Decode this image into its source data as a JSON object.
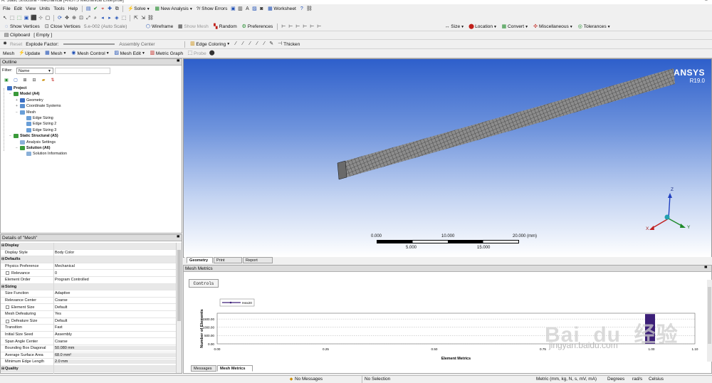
{
  "window": {
    "title": "A: Static Structural - Mechanical [ANSYS Mechanical Enterprise]"
  },
  "menu": [
    "File",
    "Edit",
    "View",
    "Units",
    "Tools",
    "Help"
  ],
  "toolbar1": {
    "solve": "Solve",
    "new_analysis": "New Analysis",
    "show_errors": "?/ Show Errors",
    "worksheet": "Worksheet"
  },
  "toolbar2": {},
  "toolbar3": {
    "show_vertices": "Show Vertices",
    "close_vertices": "Close Vertices",
    "tolerance": "5.e-002 (Auto Scale)",
    "wireframe": "Wireframe",
    "show_mesh": "Show Mesh",
    "random": "Random",
    "preferences": "Preferences",
    "size": "Size",
    "location": "Location",
    "convert": "Convert",
    "misc": "Miscellaneous",
    "tolerances": "Tolerances"
  },
  "toolbar4": {
    "clipboard": "Clipboard",
    "clipboard_state": "[ Empty ]"
  },
  "toolbar5": {
    "reset": "Reset",
    "explode_factor": "Explode Factor:",
    "assembly_center": "Assembly Center",
    "edge_coloring": "Edge Coloring",
    "thicken": "Thicken"
  },
  "toolbar6": {
    "mesh": "Mesh",
    "update": "Update",
    "mesh_menu": "Mesh",
    "mesh_control": "Mesh Control",
    "mesh_edit": "Mesh Edit",
    "metric_graph": "Metric Graph",
    "probe": "Probe"
  },
  "outline": {
    "title": "Outline",
    "pin": "▀",
    "filter_label": "Filter:",
    "filter_value": "Name",
    "nodes": [
      {
        "label": "Project",
        "level": 0,
        "bold": true,
        "color": "#3a6fc4",
        "expander": ""
      },
      {
        "label": "Model (A4)",
        "level": 1,
        "bold": true,
        "color": "#3a9a3a",
        "expander": "−"
      },
      {
        "label": "Geometry",
        "level": 2,
        "bold": false,
        "color": "#3a6fc4",
        "expander": "+"
      },
      {
        "label": "Coordinate Systems",
        "level": 2,
        "bold": false,
        "color": "#5a8fd0",
        "expander": "+"
      },
      {
        "label": "Mesh",
        "level": 2,
        "bold": false,
        "color": "#6a9fd8",
        "expander": "−"
      },
      {
        "label": "Edge Sizing",
        "level": 3,
        "bold": false,
        "color": "#6a9fd8",
        "expander": ""
      },
      {
        "label": "Edge Sizing 2",
        "level": 3,
        "bold": false,
        "color": "#6a9fd8",
        "expander": ""
      },
      {
        "label": "Edge Sizing 3",
        "level": 3,
        "bold": false,
        "color": "#6a9fd8",
        "expander": ""
      },
      {
        "label": "Static Structural (A5)",
        "level": 1,
        "bold": true,
        "color": "#3a9a3a",
        "expander": "−"
      },
      {
        "label": "Analysis Settings",
        "level": 2,
        "bold": false,
        "color": "#8ab0d8",
        "expander": ""
      },
      {
        "label": "Solution (A6)",
        "level": 2,
        "bold": true,
        "color": "#3a9a3a",
        "expander": "−"
      },
      {
        "label": "Solution Information",
        "level": 3,
        "bold": false,
        "color": "#8ab0d8",
        "expander": ""
      }
    ]
  },
  "details": {
    "title": "Details of \"Mesh\"",
    "pin": "▀",
    "rows": [
      {
        "k": "Display",
        "v": "",
        "cat": true
      },
      {
        "k": "Display Style",
        "v": "Body Color"
      },
      {
        "k": "Defaults",
        "v": "",
        "cat": true
      },
      {
        "k": "Physics Preference",
        "v": "Mechanical"
      },
      {
        "k": "Relevance",
        "v": "0",
        "cb": true
      },
      {
        "k": "Element Order",
        "v": "Program Controlled"
      },
      {
        "k": "Sizing",
        "v": "",
        "cat": true
      },
      {
        "k": "Size Function",
        "v": "Adaptive"
      },
      {
        "k": "Relevance Center",
        "v": "Coarse"
      },
      {
        "k": "Element Size",
        "v": "Default",
        "cb": true
      },
      {
        "k": "Mesh Defeaturing",
        "v": "Yes"
      },
      {
        "k": "Defeature Size",
        "v": "Default",
        "cb": true
      },
      {
        "k": "Transition",
        "v": "Fast"
      },
      {
        "k": "Initial Size Seed",
        "v": "Assembly"
      },
      {
        "k": "Span Angle Center",
        "v": "Coarse"
      },
      {
        "k": "Bounding Box Diagonal",
        "v": "50.080 mm",
        "hl": true
      },
      {
        "k": "Average Surface Area",
        "v": "68.0 mm²",
        "hl": true
      },
      {
        "k": "Minimum Edge Length",
        "v": "2.0 mm",
        "hl": true
      },
      {
        "k": "Quality",
        "v": "",
        "cat": true
      }
    ]
  },
  "viewport": {
    "brand": "ANSYS",
    "version": "R19.0",
    "scale": {
      "labels_top": [
        "0.000",
        "10.000",
        "20.000 (mm)"
      ],
      "labels_bottom": [
        "5.000",
        "15.000"
      ]
    },
    "axes": {
      "x": "X",
      "y": "Y",
      "z": "Z"
    },
    "tabs": [
      "Geometry",
      "Print Preview",
      "Report Preview"
    ]
  },
  "mesh_metrics": {
    "title": "Mesh Metrics",
    "pin": "▀",
    "controls_button": "Controls",
    "tabs": [
      "Messages",
      "Mesh Metrics"
    ]
  },
  "chart_data": {
    "type": "bar",
    "legend": [
      "Hex20"
    ],
    "ylabel": "Number of Elements",
    "xlabel": "Element Metrics",
    "x_ticks": [
      "0.00",
      "0.25",
      "0.50",
      "0.75",
      "1.00",
      "1.10"
    ],
    "y_ticks": [
      "0.00",
      "500.00",
      "1000.00",
      "1500.00"
    ],
    "xlim": [
      0,
      1.1
    ],
    "ylim": [
      0,
      1850
    ],
    "bars": [
      {
        "x": 1.0,
        "y": 1800,
        "color": "#3c1f78"
      }
    ]
  },
  "status": {
    "messages": "No Messages",
    "selection": "No Selection",
    "units": "Metric (mm, kg, N, s, mV, mA)",
    "degrees": "Degrees",
    "rad": "rad/s",
    "temp": "Celsius"
  },
  "colors": {
    "viewport_top": "#2e5fcb",
    "viewport_bottom": "#ffffff",
    "mesh_bar": "#3c1f78"
  },
  "watermark": {
    "brand": "Bai  du  经验",
    "url": "jingyan.baidu.com"
  }
}
